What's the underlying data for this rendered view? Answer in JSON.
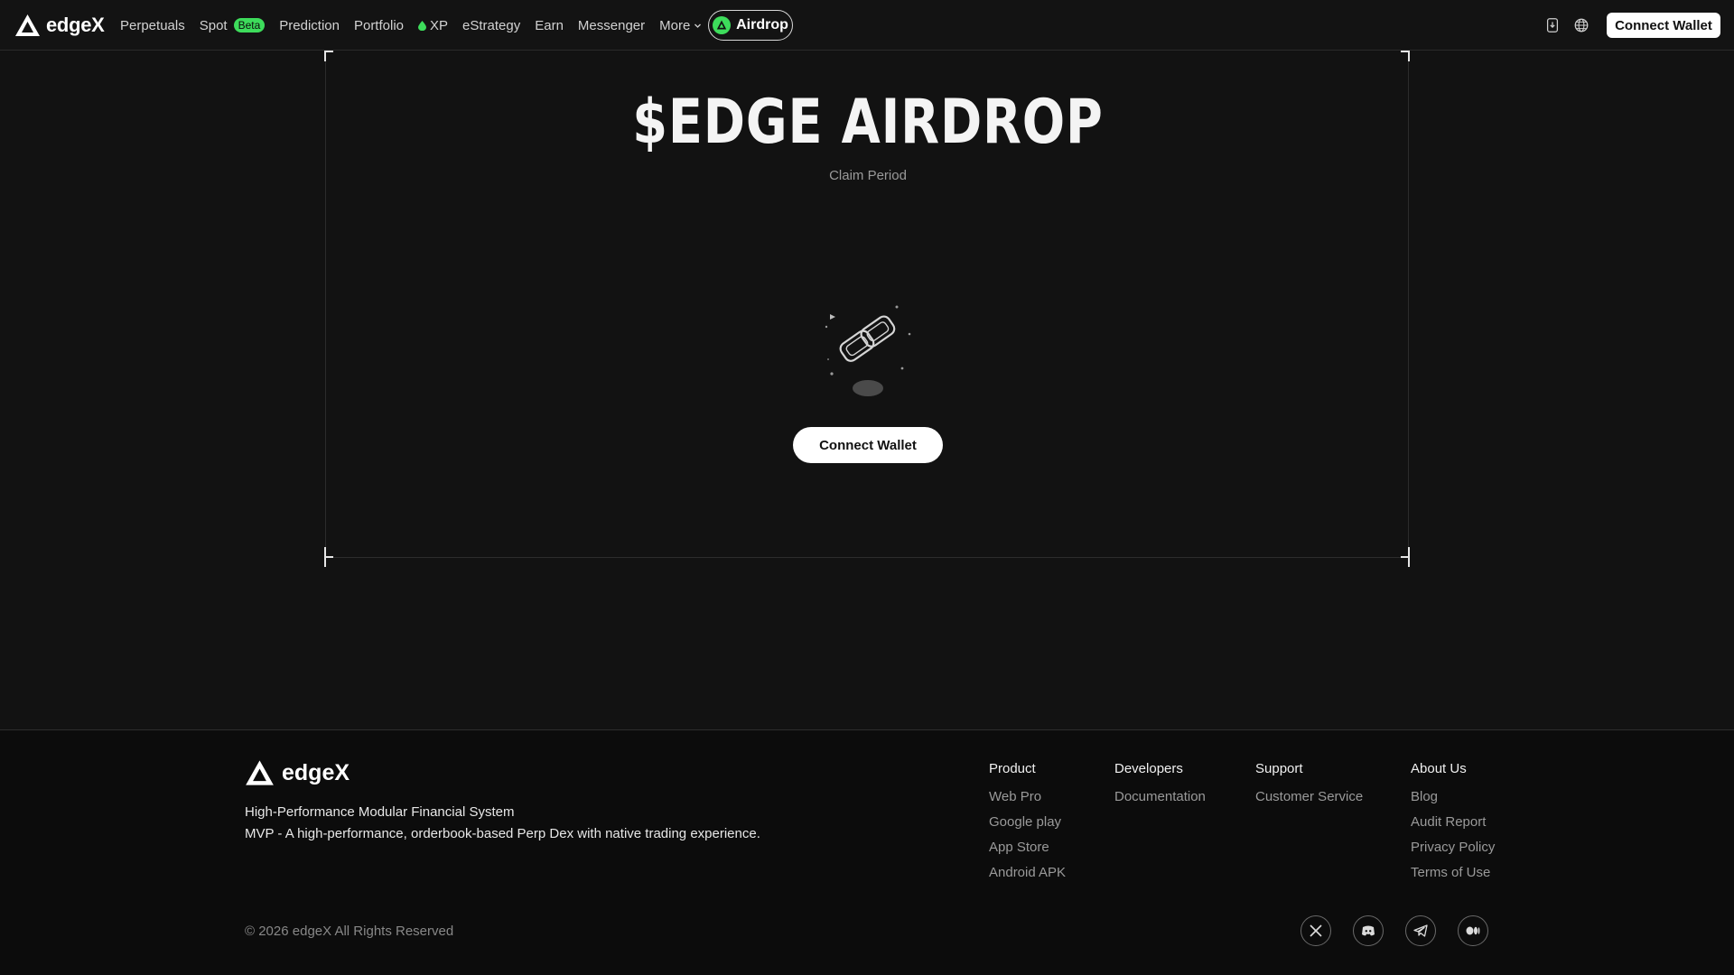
{
  "brand": {
    "name": "edgeX"
  },
  "nav": {
    "items": [
      {
        "label": "Perpetuals"
      },
      {
        "label": "Spot",
        "badge": "Beta"
      },
      {
        "label": "Prediction"
      },
      {
        "label": "Portfolio"
      },
      {
        "label": "XP"
      },
      {
        "label": "eStrategy"
      },
      {
        "label": "Earn"
      },
      {
        "label": "Messenger"
      },
      {
        "label": "More"
      }
    ],
    "airdrop_label": "Airdrop",
    "connect_label": "Connect Wallet"
  },
  "hero": {
    "title": "$EDGE AIRDROP",
    "subtitle": "Claim Period",
    "connect_label": "Connect Wallet"
  },
  "footer": {
    "tagline": "High-Performance Modular Financial System",
    "description": "MVP - A high-performance, orderbook-based Perp Dex with native trading experience.",
    "copyright": "© 2026 edgeX All Rights Reserved",
    "columns": [
      {
        "title": "Product",
        "links": [
          "Web Pro",
          "Google play",
          "App Store",
          "Android APK"
        ]
      },
      {
        "title": "Developers",
        "links": [
          "Documentation"
        ]
      },
      {
        "title": "Support",
        "links": [
          "Customer Service"
        ]
      },
      {
        "title": "About Us",
        "links": [
          "Blog",
          "Audit Report",
          "Privacy Policy",
          "Terms of Use"
        ]
      }
    ],
    "socials": [
      "x-icon",
      "discord-icon",
      "telegram-icon",
      "medium-icon"
    ]
  },
  "colors": {
    "background": "#121212",
    "accent_green": "#3ddc5b",
    "button_bg": "#ffffff"
  }
}
